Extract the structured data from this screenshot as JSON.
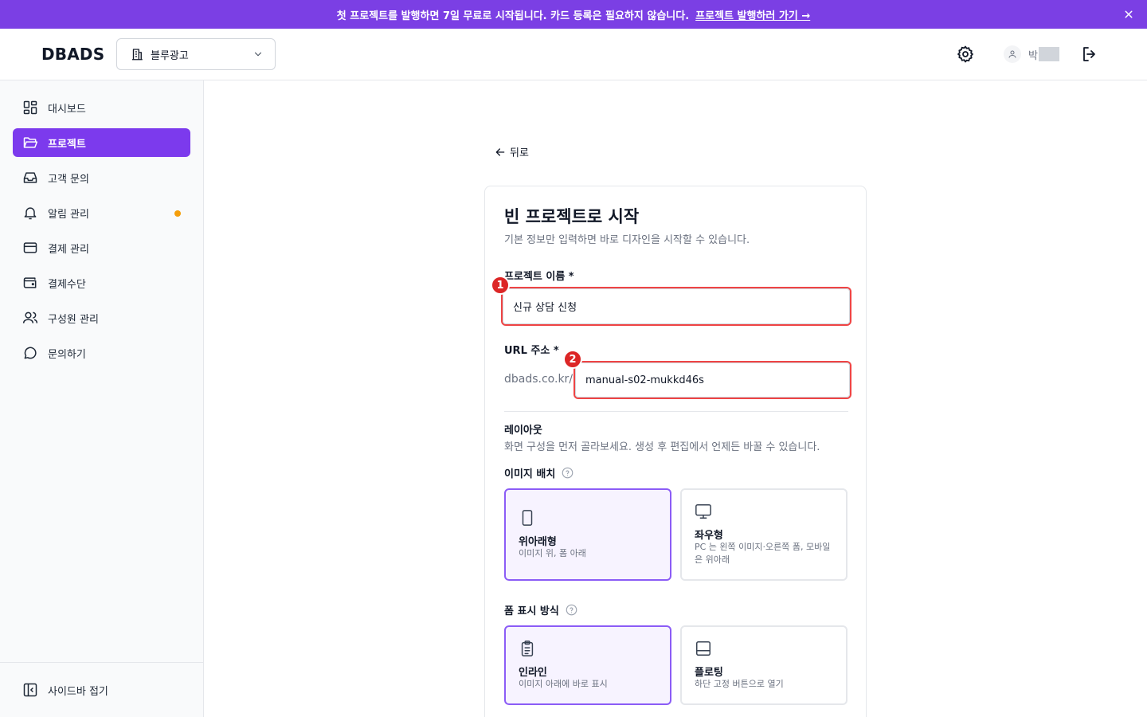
{
  "banner": {
    "text": "첫 프로젝트를 발행하면 7일 무료로 시작됩니다. 카드 등록은 필요하지 않습니다.",
    "link": "프로젝트 발행하러 가기 →"
  },
  "header": {
    "logo": "DBADS",
    "workspace": "블루광고",
    "user_name": "박"
  },
  "sidebar": {
    "items": [
      {
        "label": "대시보드",
        "icon": "dashboard-icon"
      },
      {
        "label": "프로젝트",
        "icon": "folder-icon"
      },
      {
        "label": "고객 문의",
        "icon": "inbox-icon"
      },
      {
        "label": "알림 관리",
        "icon": "bell-icon"
      },
      {
        "label": "결제 관리",
        "icon": "credit-card-icon"
      },
      {
        "label": "결제수단",
        "icon": "wallet-icon"
      },
      {
        "label": "구성원 관리",
        "icon": "users-icon"
      },
      {
        "label": "문의하기",
        "icon": "chat-icon"
      }
    ],
    "collapse_label": "사이드바 접기"
  },
  "main": {
    "back_label": "뒤로",
    "title": "빈 프로젝트로 시작",
    "subtitle": "기본 정보만 입력하면 바로 디자인을 시작할 수 있습니다.",
    "project_name": {
      "label": "프로젝트 이름 *",
      "value": "신규 상담 신청",
      "badge": "1"
    },
    "url": {
      "label": "URL 주소 *",
      "prefix": "dbads.co.kr/",
      "value": "manual-s02-mukkd46s",
      "badge": "2"
    },
    "layout": {
      "title": "레이아웃",
      "desc": "화면 구성을 먼저 골라보세요. 생성 후 편집에서 언제든 바꿀 수 있습니다."
    },
    "image_placement": {
      "label": "이미지 배치",
      "options": [
        {
          "title": "위아래형",
          "desc": "이미지 위, 폼 아래",
          "selected": true
        },
        {
          "title": "좌우형",
          "desc": "PC 는 왼쪽 이미지·오른쪽 폼, 모바일은 위아래",
          "selected": false
        }
      ]
    },
    "form_display": {
      "label": "폼 표시 방식",
      "options": [
        {
          "title": "인라인",
          "desc": "이미지 아래에 바로 표시",
          "selected": true
        },
        {
          "title": "플로팅",
          "desc": "하단 고정 버튼으로 열기",
          "selected": false
        }
      ]
    }
  },
  "colors": {
    "accent": "#7c3aed",
    "banner": "#7b3fe4",
    "highlight": "#ef4444",
    "notification_dot": "#f59e0b"
  }
}
